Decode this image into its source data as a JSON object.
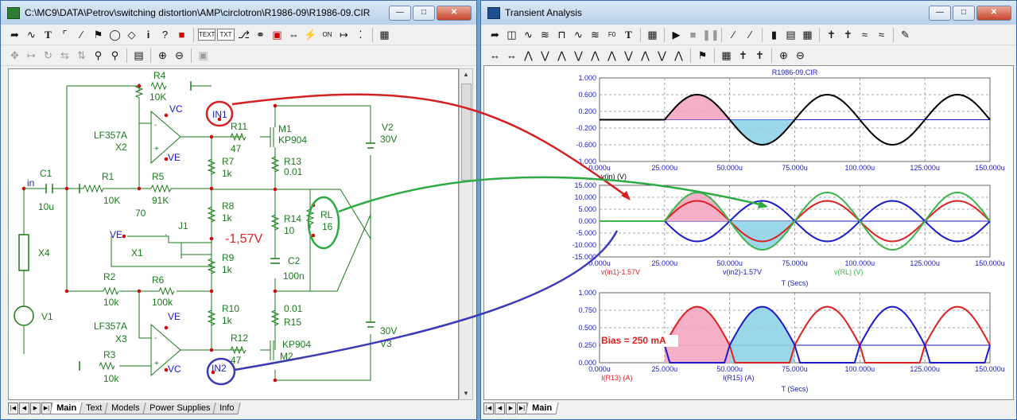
{
  "schematic_window": {
    "title": "C:\\MC9\\DATA\\Petrov\\switching distortion\\AMP\\circlotron\\R1986-09\\R1986-09.CIR",
    "tabs": [
      "Main",
      "Text",
      "Models",
      "Power Supplies",
      "Info"
    ],
    "active_tab": "Main",
    "labels": {
      "r4": "R4",
      "r4v": "10K",
      "vc1": "VC",
      "ve1": "VE",
      "opamp1": "LF357A",
      "x2": "X2",
      "in1": "IN1",
      "r11": "R11",
      "r11v": "47",
      "m1": "M1",
      "kp1": "KP904",
      "r7": "R7",
      "r7v": "1k",
      "r13": "R13",
      "r13v": "0.01",
      "v2": "V2",
      "v2v": "30V",
      "c1": "C1",
      "in": "in",
      "c1v": "10u",
      "r1": "R1",
      "r1v": "10K",
      "r5": "R5",
      "r5v": "91K",
      "r8": "R8",
      "r8v": "1k",
      "r14": "R14",
      "r14v": "10",
      "rl": "RL",
      "rlv": "16",
      "seventy": "70",
      "ve_pot": "VE",
      "x1": "X1",
      "j1": "J1",
      "dot": ".",
      "bias_v": "-1,57V",
      "x4": "X4",
      "r9": "R9",
      "r9v": "1k",
      "c2": "C2",
      "c2v": "100n",
      "r2": "R2",
      "r2v": "10k",
      "r6": "R6",
      "r6v": "100k",
      "r10": "R10",
      "r10v": "1k",
      "r15v": "0.01",
      "r15": "R15",
      "v1": "V1",
      "opamp2": "LF357A",
      "x3": "X3",
      "ve2": "VE",
      "vc2": "VC",
      "r12": "R12",
      "r12v": "47",
      "kp2": "KP904",
      "m2": "M2",
      "r3": "R3",
      "r3v": "10k",
      "in2": "IN2",
      "v3v": "30V",
      "v3": "V3"
    }
  },
  "analysis_window": {
    "title": "Transient Analysis",
    "tabs": [
      "Main"
    ],
    "active_tab": "Main",
    "xlabel": "T (Secs)",
    "plot_title": "R1986-09.CIR",
    "bias_annotation": "Bias = 250 mA"
  },
  "colors": {
    "red": "#e02020",
    "blue": "#1a1acc",
    "green": "#3cb44b",
    "black": "#000000",
    "pink_fill": "#f4a6c0",
    "cyan_fill": "#8fd3e6",
    "circuit_green": "#1a7a1a",
    "callout_red": "#d42020",
    "callout_green": "#2eaa44",
    "callout_blue": "#3b3bb5"
  },
  "chart_data": [
    {
      "type": "line",
      "x": [
        0,
        25,
        50,
        75,
        100,
        125,
        150
      ],
      "x_tick_labels": [
        "0.000u",
        "25.000u",
        "50.000u",
        "75.000u",
        "100.000u",
        "125.000u",
        "150.000u"
      ],
      "ylim": [
        -1,
        1
      ],
      "y_tick_labels": [
        "1.000",
        "0.600",
        "0.200",
        "-0.200",
        "-0.600",
        "-1.000"
      ],
      "xlabel": "T (Secs)",
      "title": "R1986-09.CIR",
      "series": [
        {
          "name": "v(in) (V)",
          "color": "#000000",
          "amplitude": 0.6,
          "period_us": 50,
          "start_us": 25,
          "t": [
            0,
            25,
            37.5,
            50,
            62.5,
            75,
            87.5,
            100,
            112.5,
            125,
            137.5,
            150
          ],
          "values": [
            0,
            0,
            0.6,
            0,
            -0.6,
            0,
            0.6,
            0,
            -0.6,
            0,
            0.6,
            0
          ]
        }
      ]
    },
    {
      "type": "line",
      "x": [
        0,
        25,
        50,
        75,
        100,
        125,
        150
      ],
      "x_tick_labels": [
        "0.000u",
        "25.000u",
        "50.000u",
        "75.000u",
        "100.000u",
        "125.000u",
        "150.000u"
      ],
      "ylim": [
        -15,
        15
      ],
      "y_tick_labels": [
        "15.000",
        "10.000",
        "5.000",
        "0.000",
        "-5.000",
        "-10.000",
        "-15.000"
      ],
      "xlabel": "T (Secs)",
      "series": [
        {
          "name": "v(in1)-1.57V",
          "color": "#e02020",
          "amplitude": 8.5,
          "phase": 1
        },
        {
          "name": "v(in2)-1.57V",
          "color": "#1a1acc",
          "amplitude": 8.5,
          "phase": -1
        },
        {
          "name": "v(RL) (V)",
          "color": "#3cb44b",
          "amplitude": 12,
          "phase": 1
        }
      ]
    },
    {
      "type": "line",
      "x": [
        0,
        25,
        50,
        75,
        100,
        125,
        150
      ],
      "x_tick_labels": [
        "0.000u",
        "25.000u",
        "50.000u",
        "75.000u",
        "100.000u",
        "125.000u",
        "150.000u"
      ],
      "ylim": [
        0,
        1
      ],
      "y_tick_labels": [
        "1.000",
        "0.750",
        "0.500",
        "0.250",
        "0.000"
      ],
      "xlabel": "T (Secs)",
      "series": [
        {
          "name": "I(R13) (A)",
          "color": "#e02020",
          "idle": 0.25,
          "peak": 0.8,
          "phase": 1
        },
        {
          "name": "I(R15) (A)",
          "color": "#1a1acc",
          "idle": 0.25,
          "peak": 0.8,
          "phase": -1
        }
      ]
    }
  ]
}
